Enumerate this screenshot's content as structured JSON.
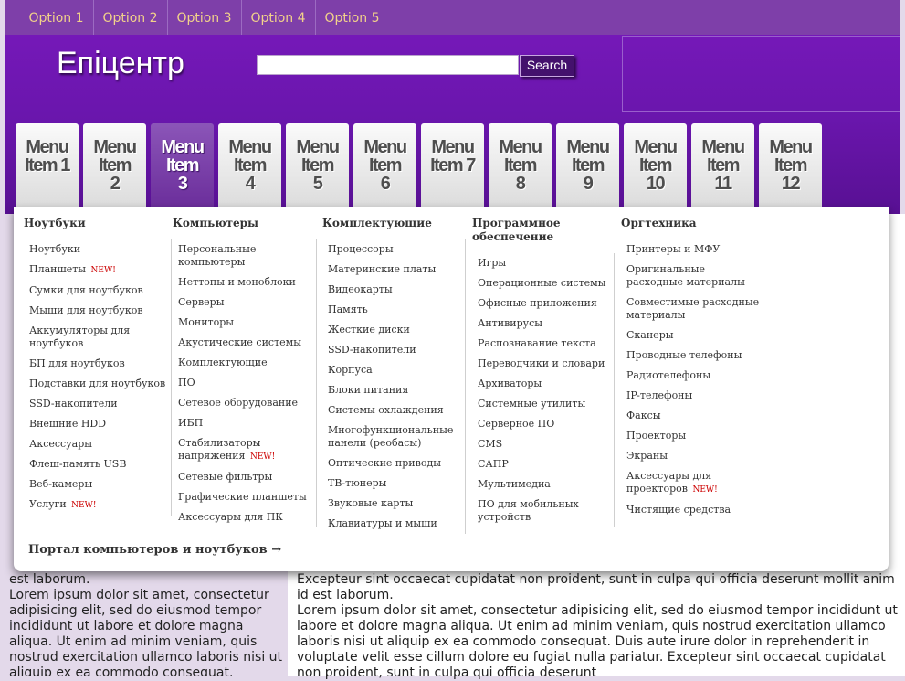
{
  "top_options": [
    "Option 1",
    "Option 2",
    "Option 3",
    "Option 4",
    "Option 5"
  ],
  "header": {
    "logo": "Епіцентр",
    "search_value": "",
    "search_button": "Search"
  },
  "tabs": [
    {
      "l1": "Menu",
      "l2": "Item 1",
      "active": false
    },
    {
      "l1": "Menu",
      "l2": "Item",
      "l3": "2",
      "active": false
    },
    {
      "l1": "Menu",
      "l2": "Item",
      "l3": "3",
      "active": true
    },
    {
      "l1": "Menu",
      "l2": "Item",
      "l3": "4",
      "active": false
    },
    {
      "l1": "Menu",
      "l2": "Item",
      "l3": "5",
      "active": false
    },
    {
      "l1": "Menu",
      "l2": "Item",
      "l3": "6",
      "active": false
    },
    {
      "l1": "Menu",
      "l2": "Item 7",
      "active": false
    },
    {
      "l1": "Menu",
      "l2": "Item",
      "l3": "8",
      "active": false
    },
    {
      "l1": "Menu",
      "l2": "Item",
      "l3": "9",
      "active": false
    },
    {
      "l1": "Menu",
      "l2": "Item",
      "l3": "10",
      "active": false
    },
    {
      "l1": "Menu",
      "l2": "Item",
      "l3": "11",
      "active": false
    },
    {
      "l1": "Menu",
      "l2": "Item",
      "l3": "12",
      "active": false
    }
  ],
  "dropdown": {
    "columns": [
      {
        "title": "Ноутбуки",
        "items": [
          {
            "label": "Ноутбуки"
          },
          {
            "label": "Планшеты",
            "new": "NEW!"
          },
          {
            "label": "Сумки для ноутбуков"
          },
          {
            "label": "Мыши для ноутбуков"
          },
          {
            "label": "Аккумуляторы для ноутбуков"
          },
          {
            "label": "БП для ноутбуков"
          },
          {
            "label": "Подставки для ноутбуков"
          },
          {
            "label": "SSD-накопители"
          },
          {
            "label": "Внешние HDD"
          },
          {
            "label": "Аксессуары"
          },
          {
            "label": "Флеш-память USB"
          },
          {
            "label": "Веб-камеры"
          },
          {
            "label": "Услуги",
            "new": "NEW!"
          }
        ]
      },
      {
        "title": "Компьютеры",
        "items": [
          {
            "label": "Персональные компьютеры"
          },
          {
            "label": "Неттопы и моноблоки"
          },
          {
            "label": "Серверы"
          },
          {
            "label": "Мониторы"
          },
          {
            "label": "Акустические системы"
          },
          {
            "label": "Комплектующие"
          },
          {
            "label": "ПО"
          },
          {
            "label": "Сетевое оборудование"
          },
          {
            "label": "ИБП"
          },
          {
            "label": "Стабилизаторы напряжения",
            "new": "NEW!"
          },
          {
            "label": "Сетевые фильтры"
          },
          {
            "label": "Графические планшеты"
          },
          {
            "label": "Аксессуары для ПК"
          }
        ]
      },
      {
        "title": "Комплектующие",
        "items": [
          {
            "label": "Процессоры"
          },
          {
            "label": "Материнские платы"
          },
          {
            "label": "Видеокарты"
          },
          {
            "label": "Память"
          },
          {
            "label": "Жесткие диски"
          },
          {
            "label": "SSD-накопители"
          },
          {
            "label": "Корпуса"
          },
          {
            "label": "Блоки питания"
          },
          {
            "label": "Системы охлаждения"
          },
          {
            "label": "Многофункциональные панели (реобасы)"
          },
          {
            "label": "Оптические приводы"
          },
          {
            "label": "ТВ-тюнеры"
          },
          {
            "label": "Звуковые карты"
          },
          {
            "label": "Клавиатуры и мыши"
          }
        ]
      },
      {
        "title": "Программное обеспечение",
        "items": [
          {
            "label": "Игры"
          },
          {
            "label": "Операционные системы"
          },
          {
            "label": "Офисные приложения"
          },
          {
            "label": "Антивирусы"
          },
          {
            "label": "Распознавание текста"
          },
          {
            "label": "Переводчики и словари"
          },
          {
            "label": "Архиваторы"
          },
          {
            "label": "Системные утилиты"
          },
          {
            "label": "Серверное ПО"
          },
          {
            "label": "CMS"
          },
          {
            "label": "САПР"
          },
          {
            "label": "Мультимедиа"
          },
          {
            "label": "ПО для мобильных устройств"
          }
        ]
      },
      {
        "title": "Оргтехника",
        "items": [
          {
            "label": "Принтеры и МФУ"
          },
          {
            "label": "Оригинальные расходные материалы"
          },
          {
            "label": "Совместимые расходные материалы"
          },
          {
            "label": "Сканеры"
          },
          {
            "label": "Проводные телефоны"
          },
          {
            "label": "Радиотелефоны"
          },
          {
            "label": "IP-телефоны"
          },
          {
            "label": "Факсы"
          },
          {
            "label": "Проекторы"
          },
          {
            "label": "Экраны"
          },
          {
            "label": "Аксессуары для проекторов",
            "new": "NEW!"
          },
          {
            "label": "Чистящие средства"
          }
        ]
      }
    ],
    "portal_link": "Портал компьютеров и ноутбуков →"
  },
  "left_text": "est laborum.\nLorem ipsum dolor sit amet, consectetur adipisicing elit, sed do eiusmod tempor incididunt ut labore et dolore magna aliqua. Ut enim ad minim veniam, quis nostrud exercitation ullamco laboris nisi ut aliquip ex ea commodo consequat.",
  "main_text": "Excepteur sint occaecat cupidatat non proident, sunt in culpa qui officia deserunt mollit anim id est laborum.\nLorem ipsum dolor sit amet, consectetur adipisicing elit, sed do eiusmod tempor incididunt ut labore et dolore magna aliqua. Ut enim ad minim veniam, quis nostrud exercitation ullamco laboris nisi ut aliquip ex ea commodo consequat. Duis aute irure dolor in reprehenderit in voluptate velit esse cillum dolore eu fugiat nulla pariatur. Excepteur sint occaecat cupidatat non proident, sunt in culpa qui officia deserunt"
}
